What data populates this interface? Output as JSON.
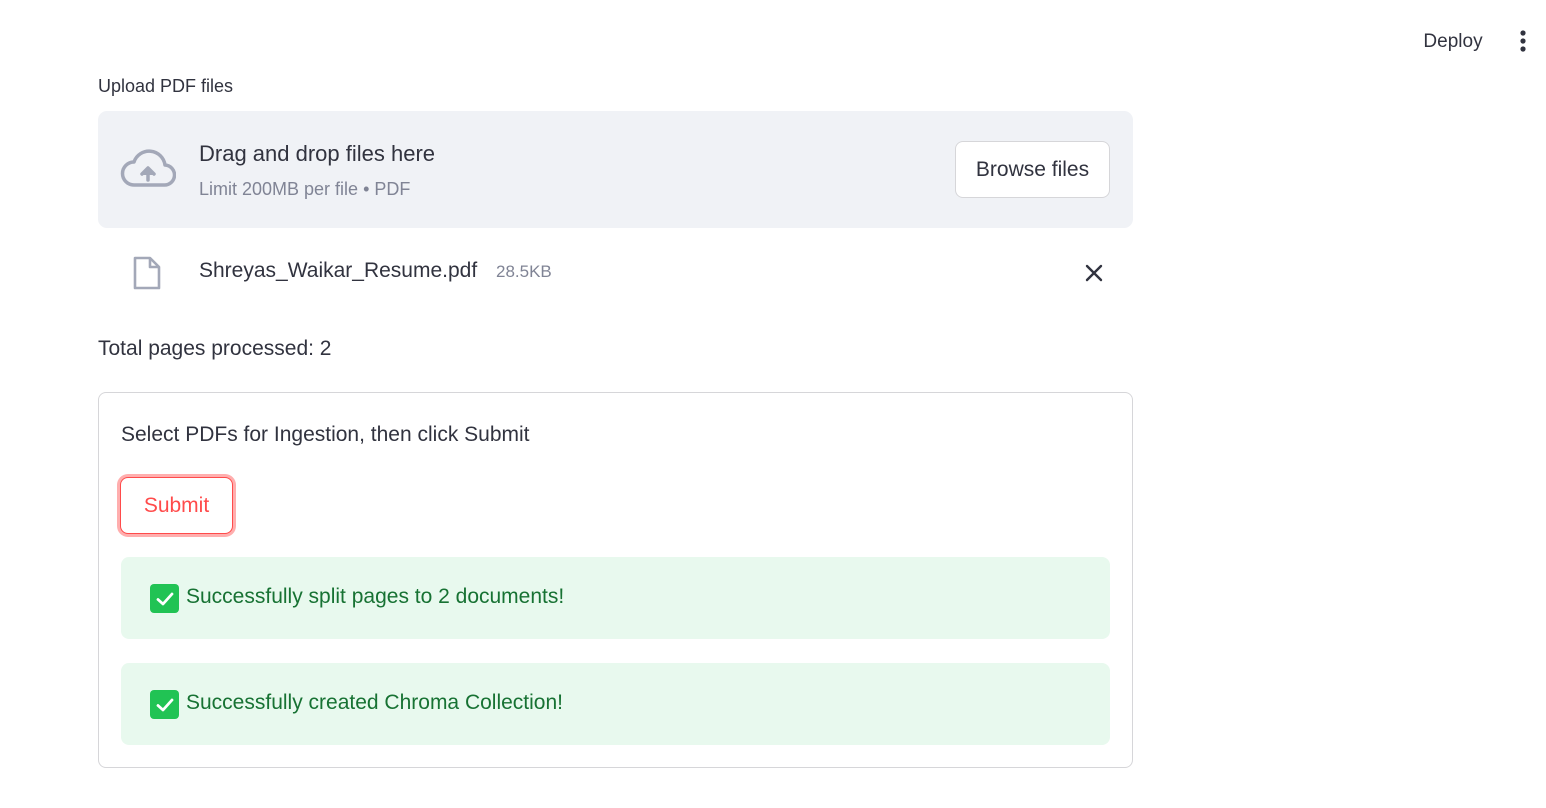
{
  "header": {
    "deploy_label": "Deploy",
    "menu_icon": "kebab-menu-icon"
  },
  "uploader": {
    "label": "Upload PDF files",
    "dropzone_title": "Drag and drop files here",
    "dropzone_subtitle": "Limit 200MB per file • PDF",
    "browse_label": "Browse files",
    "cloud_icon": "cloud-upload-icon"
  },
  "uploaded_file": {
    "name": "Shreyas_Waikar_Resume.pdf",
    "size": "28.5KB",
    "file_icon": "file-icon",
    "remove_icon": "close-icon"
  },
  "status": {
    "total_pages": "Total pages processed: 2"
  },
  "form": {
    "instruction": "Select PDFs for Ingestion, then click Submit",
    "submit_label": "Submit",
    "alerts": [
      {
        "text": "Successfully split pages to 2 documents!",
        "icon": "check-icon"
      },
      {
        "text": "Successfully created Chroma Collection!",
        "icon": "check-icon"
      }
    ]
  },
  "colors": {
    "primary": "#ff4b4b",
    "success_bg": "#e8f9ee",
    "success_text": "#177233",
    "dropzone_bg": "#f0f2f6"
  }
}
